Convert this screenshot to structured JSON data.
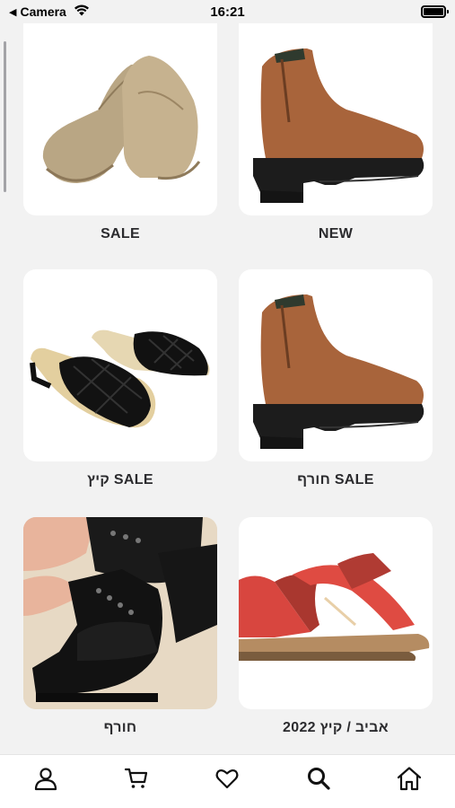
{
  "status_bar": {
    "back_app": "Camera",
    "time": "16:21",
    "battery_level": 1.0
  },
  "categories": [
    {
      "label": "SALE",
      "image": "beige-loafer"
    },
    {
      "label": "NEW",
      "image": "brown-ankle-boot"
    },
    {
      "label": "קיץ SALE",
      "image": "black-woven-sandal"
    },
    {
      "label": "חורף SALE",
      "image": "brown-ankle-boot"
    },
    {
      "label": "חורף",
      "image": "black-lace-up-boot"
    },
    {
      "label": "אביב / קיץ 2022",
      "image": "red-strap-sandal"
    }
  ],
  "tab_bar": {
    "items": [
      {
        "icon": "person-icon"
      },
      {
        "icon": "cart-icon"
      },
      {
        "icon": "heart-icon"
      },
      {
        "icon": "search-icon",
        "active": true
      },
      {
        "icon": "home-icon"
      }
    ]
  },
  "colors": {
    "background": "#f2f2f2",
    "card": "#ffffff",
    "label": "#2b2b2e",
    "icon": "#111111"
  }
}
